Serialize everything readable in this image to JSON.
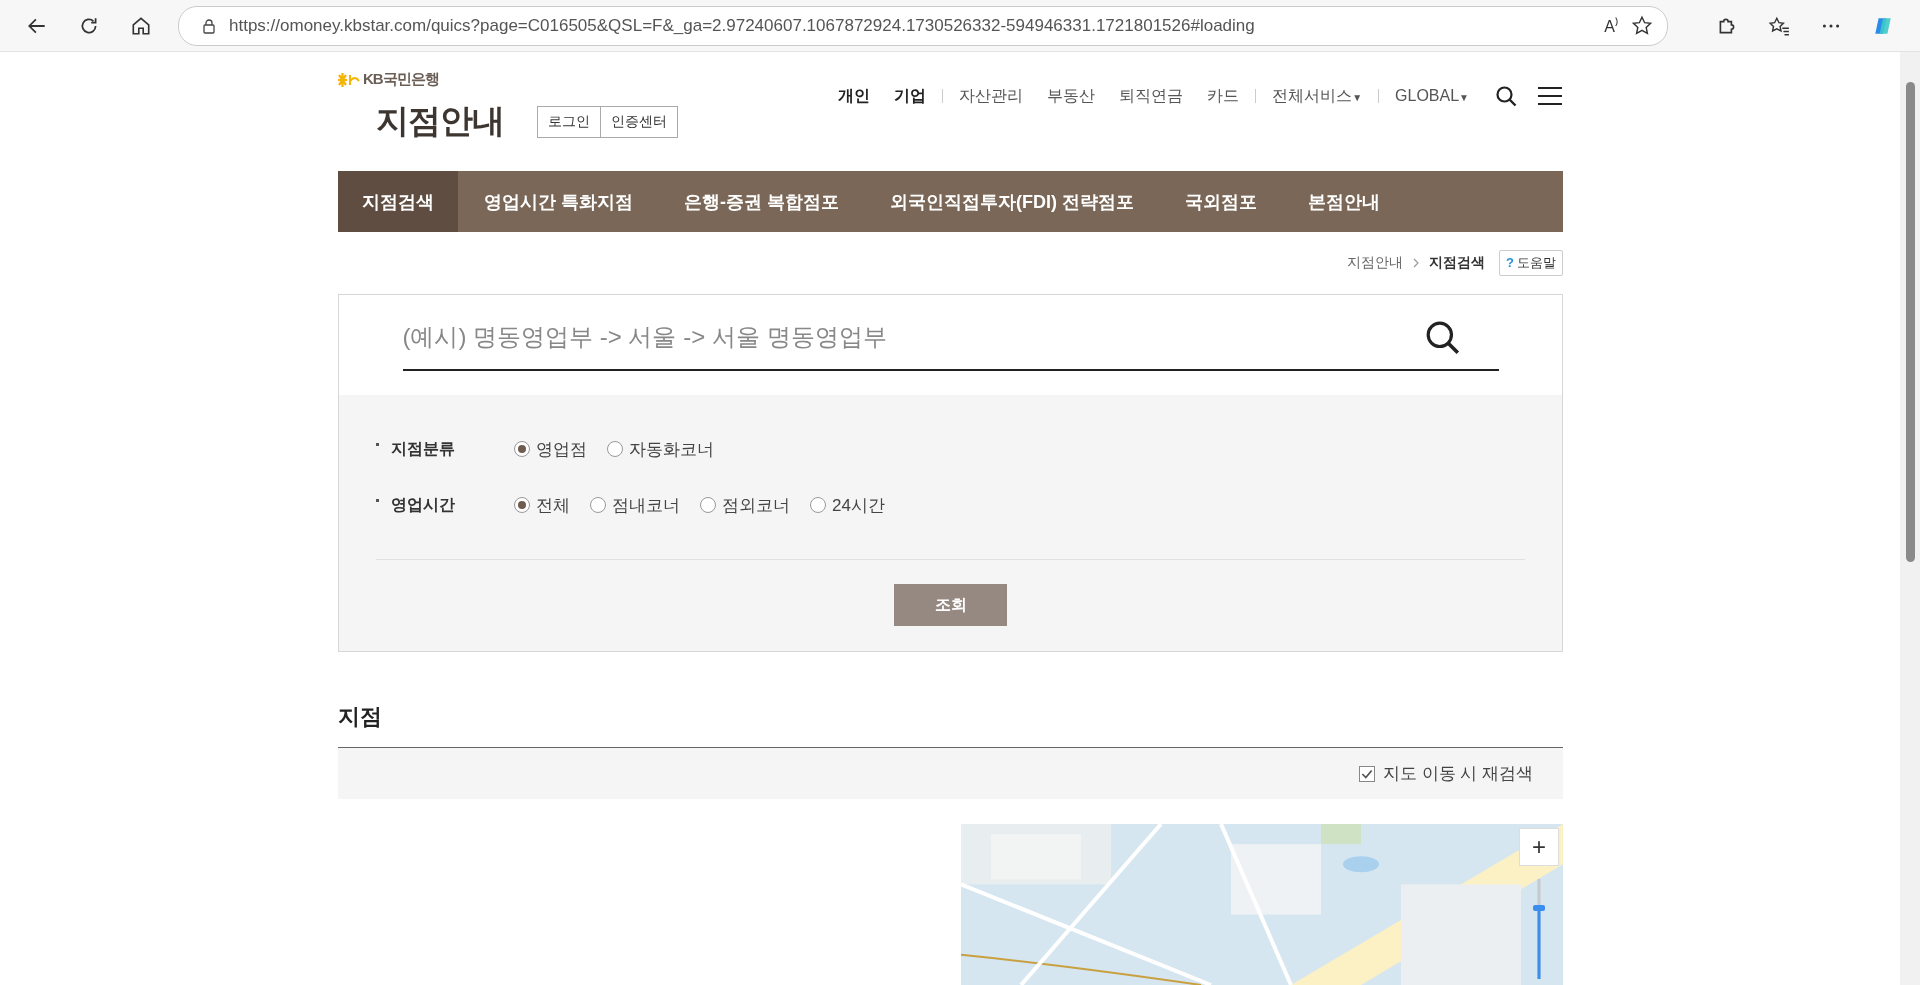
{
  "browser": {
    "url": "https://omoney.kbstar.com/quics?page=C016505&QSL=F&_ga=2.97240607.1067872924.1730526332-594946331.1721801526#loading",
    "read_aloud": "A⁾"
  },
  "header": {
    "logo": "KB국민은행",
    "title": "지점안내",
    "auth_buttons": [
      "로그인",
      "인증센터"
    ],
    "menu_groups": [
      {
        "emphasis": true,
        "items": [
          {
            "label": "개인"
          },
          {
            "label": "기업"
          }
        ]
      },
      {
        "emphasis": false,
        "items": [
          {
            "label": "자산관리"
          },
          {
            "label": "부동산"
          },
          {
            "label": "퇴직연금"
          },
          {
            "label": "카드"
          }
        ]
      },
      {
        "emphasis": false,
        "items": [
          {
            "label": "전체서비스",
            "caret": "▼"
          }
        ]
      },
      {
        "emphasis": false,
        "items": [
          {
            "label": "GLOBAL",
            "caret": "▼"
          }
        ]
      }
    ]
  },
  "tabs": [
    {
      "label": "지점검색",
      "selected": true
    },
    {
      "label": "영업시간 특화지점",
      "selected": false
    },
    {
      "label": "은행-증권 복합점포",
      "selected": false
    },
    {
      "label": "외국인직접투자(FDI) 전략점포",
      "selected": false
    },
    {
      "label": "국외점포",
      "selected": false
    },
    {
      "label": "본점안내",
      "selected": false
    }
  ],
  "breadcrumb": [
    "지점안내",
    "지점검색"
  ],
  "help": {
    "mark": "?",
    "label": "도움말"
  },
  "search": {
    "placeholder": "(예시) 명동영업부 -> 서울 -> 서울 명동영업부"
  },
  "filters": [
    {
      "label": "지점분류",
      "options": [
        {
          "label": "영업점",
          "selected": true
        },
        {
          "label": "자동화코너",
          "selected": false
        }
      ]
    },
    {
      "label": "영업시간",
      "options": [
        {
          "label": "전체",
          "selected": true
        },
        {
          "label": "점내코너",
          "selected": false
        },
        {
          "label": "점외코너",
          "selected": false
        },
        {
          "label": "24시간",
          "selected": false
        }
      ]
    }
  ],
  "submit": "조회",
  "section": {
    "title": "지점",
    "recheck": {
      "label": "지도 이동 시 재검색",
      "checked": true
    }
  },
  "map": {
    "kind": "picture",
    "zoom_in": "+"
  }
}
